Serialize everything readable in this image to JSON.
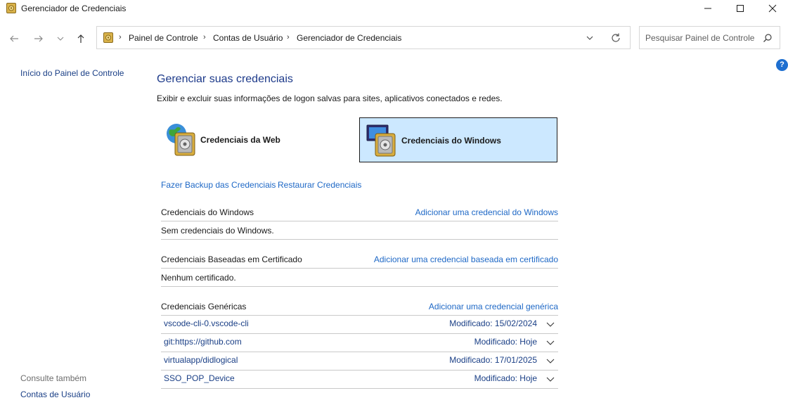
{
  "window": {
    "title": "Gerenciador de Credenciais"
  },
  "nav": {
    "breadcrumbs": [
      "Painel de Controle",
      "Contas de Usuário",
      "Gerenciador de Credenciais"
    ],
    "search_placeholder": "Pesquisar Painel de Controle"
  },
  "left_pane": {
    "home_link": "Início do Painel de Controle",
    "see_also_label": "Consulte também",
    "see_also_link": "Contas de Usuário"
  },
  "main": {
    "title": "Gerenciar suas credenciais",
    "subtitle": "Exibir e excluir suas informações de logon salvas para sites, aplicativos conectados e redes.",
    "tiles": {
      "web": "Credenciais da Web",
      "windows": "Credenciais do Windows"
    },
    "backup_link": "Fazer Backup das Credenciais",
    "restore_link": "Restaurar Credenciais",
    "sections": {
      "windows": {
        "title": "Credenciais do Windows",
        "add_link": "Adicionar uma credencial do Windows",
        "empty": "Sem credenciais do Windows."
      },
      "certificate": {
        "title": "Credenciais Baseadas em Certificado",
        "add_link": "Adicionar uma credencial baseada em certificado",
        "empty": "Nenhum certificado."
      },
      "generic": {
        "title": "Credenciais Genéricas",
        "add_link": "Adicionar uma credencial genérica",
        "items": [
          {
            "name": "vscode-cli-0.vscode-cli",
            "modified": "Modificado:  15/02/2024"
          },
          {
            "name": "git:https://github.com",
            "modified": "Modificado:  Hoje"
          },
          {
            "name": "virtualapp/didlogical",
            "modified": "Modificado:  17/01/2025"
          },
          {
            "name": "SSO_POP_Device",
            "modified": "Modificado:  Hoje"
          }
        ]
      }
    }
  },
  "colors": {
    "link": "#1e68c6",
    "dark_link": "#1a3f86",
    "title": "#1d3a8a",
    "selected_tile": "#cce8ff"
  },
  "icons": {
    "app": "credential-vault-icon",
    "web_tile": "globe-vault-icon",
    "windows_tile": "monitor-vault-icon",
    "help": "help-icon"
  }
}
